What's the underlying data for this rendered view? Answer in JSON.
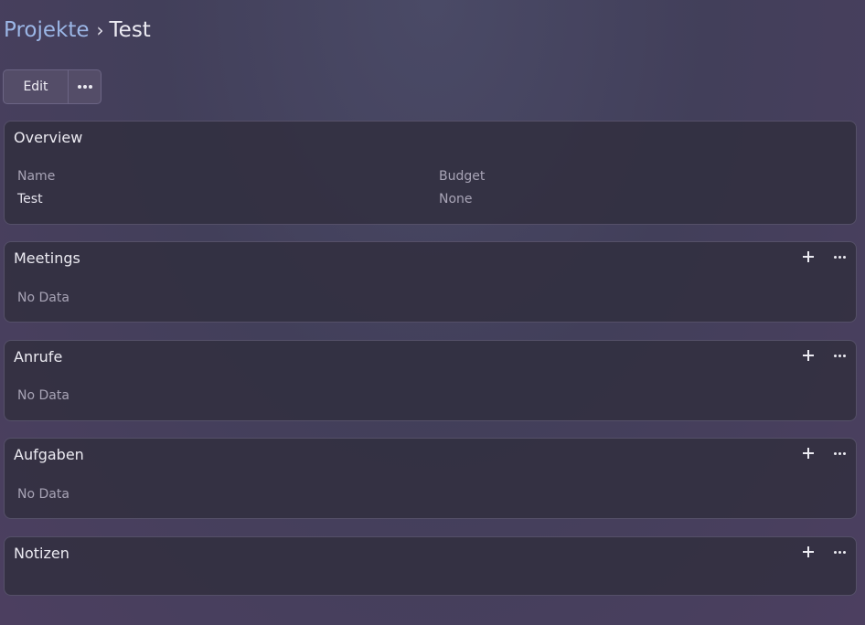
{
  "breadcrumb": {
    "parent": "Projekte",
    "separator": "›",
    "current": "Test"
  },
  "toolbar": {
    "edit_label": "Edit",
    "more_icon": "more-horizontal-icon"
  },
  "overview": {
    "title": "Overview",
    "fields": [
      {
        "label": "Name",
        "value": "Test"
      },
      {
        "label": "Budget",
        "value": "None"
      }
    ]
  },
  "panels": {
    "meetings": {
      "title": "Meetings",
      "empty": "No Data"
    },
    "anrufe": {
      "title": "Anrufe",
      "empty": "No Data"
    },
    "aufgaben": {
      "title": "Aufgaben",
      "empty": "No Data"
    },
    "notizen": {
      "title": "Notizen"
    }
  },
  "icons": {
    "add": "plus-icon",
    "menu": "more-dots-icon"
  },
  "colors": {
    "link": "#9bb6e6",
    "text": "#ecebf2",
    "muted": "#a8a4b6"
  }
}
